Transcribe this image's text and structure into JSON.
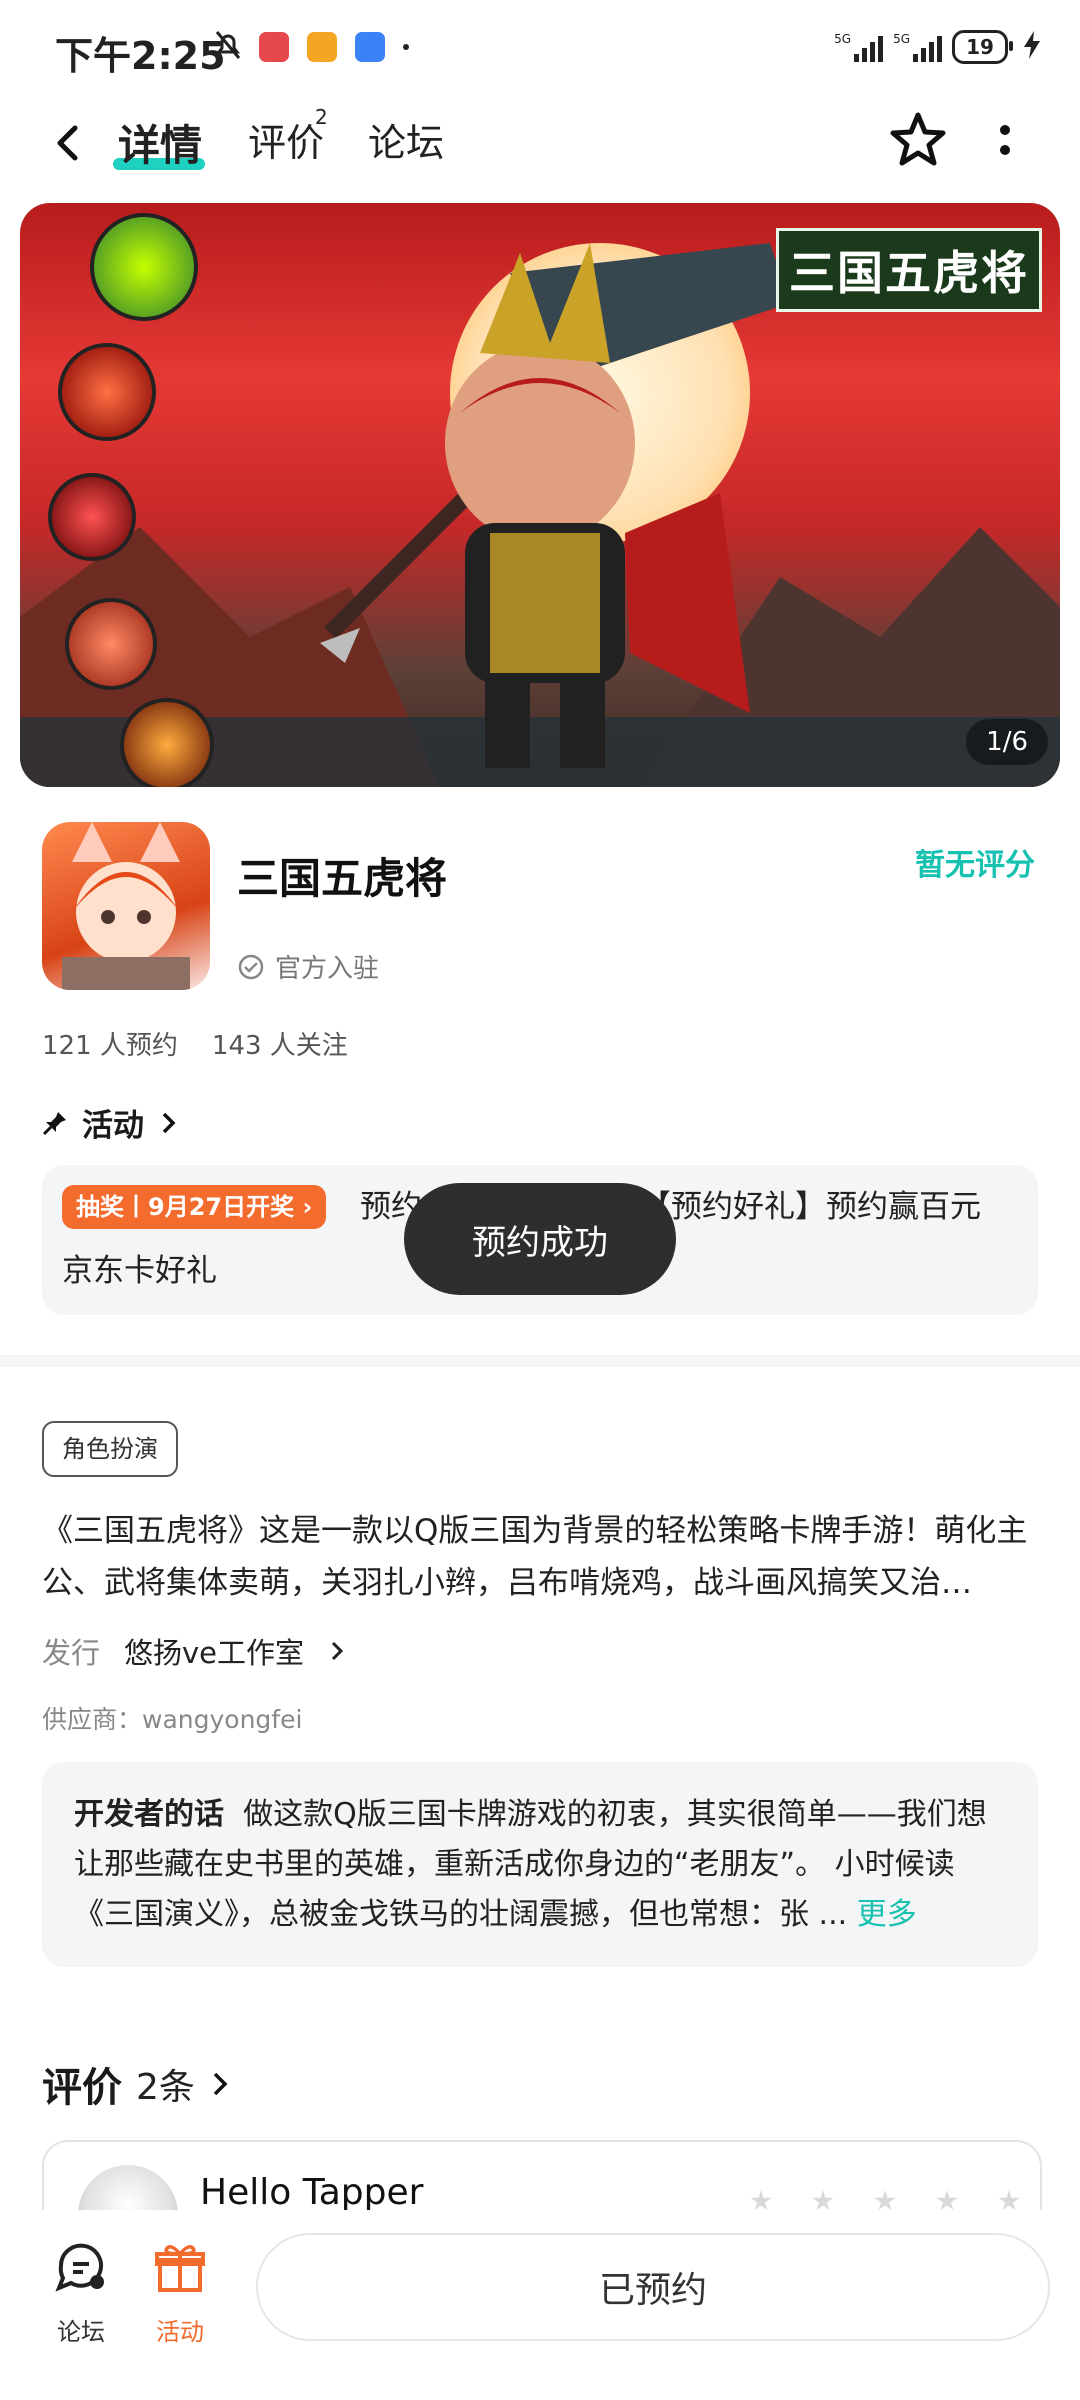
{
  "status_bar": {
    "time": "下午2:25",
    "battery": "19",
    "network": "5G"
  },
  "nav": {
    "tabs": [
      {
        "label": "详情"
      },
      {
        "label": "评价"
      },
      {
        "label": "论坛"
      }
    ],
    "review_badge": "2"
  },
  "banner": {
    "title": "三国五虎将",
    "counter": "1/6"
  },
  "app": {
    "name": "三国五虎将",
    "rating_text": "暂无评分",
    "official_label": "官方入驻",
    "reservations": "121 人预约",
    "followers": "143 人关注"
  },
  "activity": {
    "header": "活动",
    "lottery_tag": "抽奖丨9月27日开奖",
    "line1_left": "预约",
    "line1_right": "【预约好礼】预约赢百元",
    "line2": "京东卡好礼"
  },
  "toast": "预约成功",
  "genre": "角色扮演",
  "description": "《三国五虎将》这是一款以Q版三国为背景的轻松策略卡牌手游！萌化主公、武将集体卖萌，关羽扎小辫，吕布啃烧鸡，战斗画风搞笑又治…",
  "publisher": {
    "label": "发行",
    "name": "悠扬ve工作室"
  },
  "supplier": "供应商：wangyongfei",
  "developer": {
    "heading": "开发者的话",
    "text": "做这款Q版三国卡牌游戏的初衷，其实很简单——我们想让那些藏在史书里的英雄，重新活成你身边的“老朋友”。 小时候读《三国演义》，总被金戈铁马的壮阔震撼，但也常想：张 ...",
    "more": "更多"
  },
  "reviews": {
    "title": "评价",
    "count": "2条",
    "first_user": "Hello Tapper"
  },
  "bottom_bar": {
    "forum": "论坛",
    "activity": "活动",
    "reserved_button": "已预约"
  },
  "colors": {
    "accent": "#16c1b0",
    "orange": "#f46b2e",
    "toast_bg": "#2e2e2e"
  }
}
